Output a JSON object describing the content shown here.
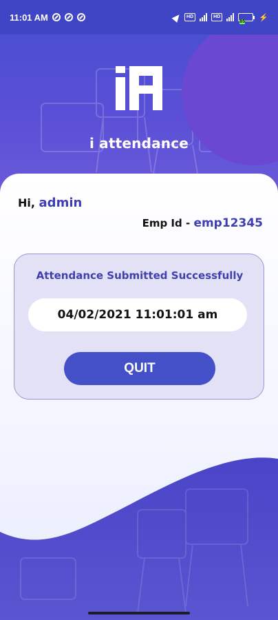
{
  "status_bar": {
    "time": "11:01 AM",
    "battery_level": "85"
  },
  "header": {
    "app_name": "i attendance"
  },
  "greeting": {
    "prefix": "Hi,",
    "username": "admin"
  },
  "employee": {
    "label": "Emp Id -",
    "id": "emp12345"
  },
  "result": {
    "message": "Attendance Submitted Successfully",
    "timestamp": "04/02/2021 11:01:01 am",
    "quit_label": "QUIT"
  },
  "icons": {
    "logo": "i-attendance-logo-icon",
    "nav": "navigation-arrow-icon",
    "signal": "cell-signal-icon",
    "battery": "battery-icon",
    "charging": "charging-bolt-icon"
  },
  "colors": {
    "primary": "#4450c8",
    "header": "#4b4fd2",
    "accent_text": "#3e3eb0",
    "panel": "#e3e1f6"
  }
}
